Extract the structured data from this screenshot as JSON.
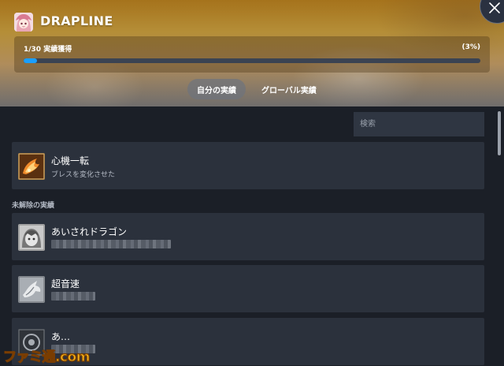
{
  "app": {
    "title": "DRAPLINE",
    "icon": "anime-character-icon"
  },
  "progress": {
    "label": "1/30 実績獲得",
    "percent_label": "(3%)",
    "fraction": 0.03
  },
  "tabs": [
    {
      "label": "自分の実績",
      "active": true
    },
    {
      "label": "グローバル実績",
      "active": false
    }
  ],
  "search": {
    "placeholder": "検索",
    "value": ""
  },
  "unlocked": [
    {
      "name": "心機一転",
      "description": "ブレスを変化させた",
      "icon": "fire-dragon-icon"
    }
  ],
  "locked_section": {
    "label": "未解除の実績"
  },
  "locked": [
    {
      "name": "あいされドラゴン",
      "icon": "character-face-icon"
    },
    {
      "name": "超音速",
      "icon": "dragon-silhouette-icon"
    },
    {
      "name": "あ…",
      "icon": "ring-creature-icon"
    }
  ],
  "watermark": {
    "text": "ファミ通.com"
  },
  "colors": {
    "accent": "#1a9fff",
    "card_bg": "#2b313c",
    "page_bg": "#1b1f27",
    "header_gold": "#c49a3c"
  }
}
